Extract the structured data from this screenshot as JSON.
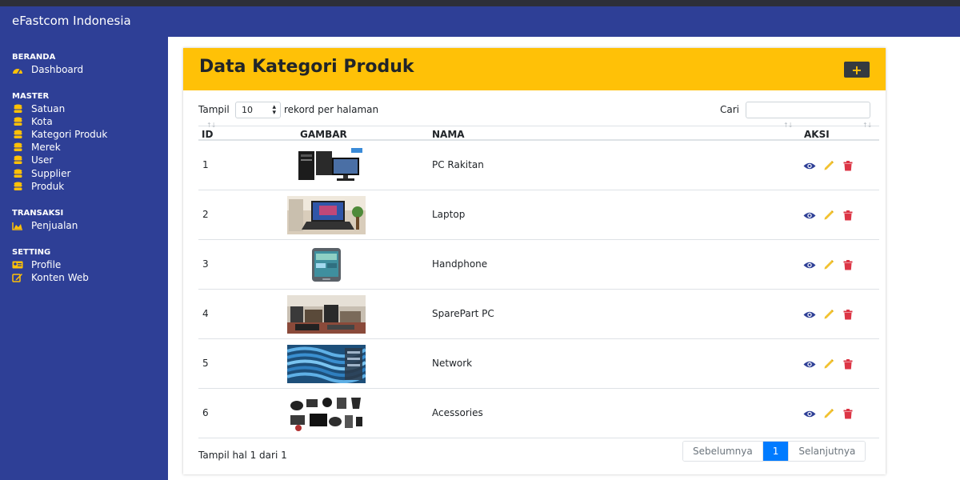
{
  "app": {
    "brand": "eFastcom Indonesia"
  },
  "sidebar": {
    "sections": [
      {
        "title": "BERANDA",
        "items": [
          {
            "label": "Dashboard",
            "icon": "tachometer-icon"
          }
        ]
      },
      {
        "title": "MASTER",
        "items": [
          {
            "label": "Satuan",
            "icon": "database-icon"
          },
          {
            "label": "Kota",
            "icon": "database-icon"
          },
          {
            "label": "Kategori Produk",
            "icon": "database-icon"
          },
          {
            "label": "Merek",
            "icon": "database-icon"
          },
          {
            "label": "User",
            "icon": "database-icon"
          },
          {
            "label": "Supplier",
            "icon": "database-icon"
          },
          {
            "label": "Produk",
            "icon": "database-icon"
          }
        ]
      },
      {
        "title": "TRANSAKSI",
        "items": [
          {
            "label": "Penjualan",
            "icon": "area-chart-icon"
          }
        ]
      },
      {
        "title": "SETTING",
        "items": [
          {
            "label": "Profile",
            "icon": "id-card-icon"
          },
          {
            "label": "Konten Web",
            "icon": "edit-icon"
          }
        ]
      }
    ]
  },
  "card": {
    "title": "Data Kategori Produk",
    "add_label": "+"
  },
  "controls": {
    "show_prefix": "Tampil",
    "page_length": "10",
    "show_suffix": "rekord per halaman",
    "search_label": "Cari",
    "search_value": ""
  },
  "table": {
    "columns": [
      "ID",
      "GAMBAR",
      "NAMA",
      "AKSI"
    ],
    "rows": [
      {
        "id": "1",
        "nama": "PC Rakitan",
        "image": "desktop-pc"
      },
      {
        "id": "2",
        "nama": "Laptop",
        "image": "laptop"
      },
      {
        "id": "3",
        "nama": "Handphone",
        "image": "smartphone"
      },
      {
        "id": "4",
        "nama": "SparePart PC",
        "image": "spare-parts"
      },
      {
        "id": "5",
        "nama": "Network",
        "image": "network-cables"
      },
      {
        "id": "6",
        "nama": "Acessories",
        "image": "accessories"
      }
    ]
  },
  "footer": {
    "info": "Tampil hal 1 dari 1",
    "prev": "Sebelumnya",
    "page": "1",
    "next": "Selanjutnya"
  },
  "colors": {
    "navbar": "#2e3f96",
    "header": "#ffc107",
    "view": "#2e3f96",
    "edit": "#f2c230",
    "delete": "#dc3545",
    "page_active": "#007bff"
  }
}
